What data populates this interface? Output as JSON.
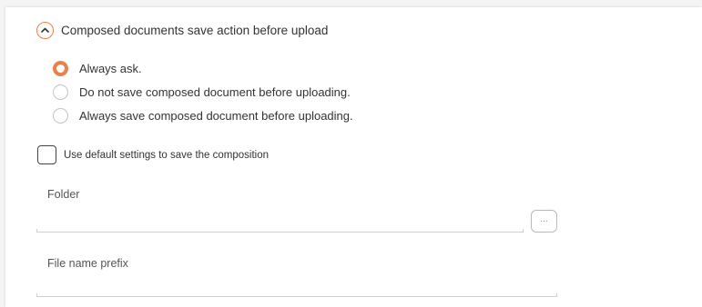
{
  "section": {
    "title": "Composed documents save action before upload",
    "collapse_icon": "chevron-up-icon",
    "accent_color": "#ec7f4f"
  },
  "save_action": {
    "selected": 0,
    "options": [
      {
        "label": "Always ask."
      },
      {
        "label": "Do not save composed document before uploading."
      },
      {
        "label": "Always save composed document before uploading."
      }
    ]
  },
  "default_settings": {
    "label": "Use default settings to save the composition",
    "checked": false
  },
  "folder": {
    "label": "Folder",
    "value": "",
    "browse_label": "..."
  },
  "file_name_prefix": {
    "label": "File name prefix",
    "value": ""
  }
}
